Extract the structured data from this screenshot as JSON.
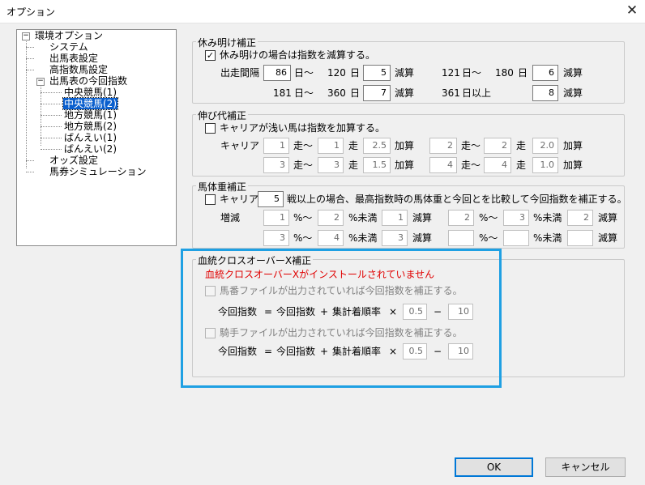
{
  "window": {
    "title": "オプション",
    "close_glyph": "✕"
  },
  "tree": {
    "items": [
      {
        "label": "環境オプション",
        "expander": "−"
      },
      {
        "label": "システム"
      },
      {
        "label": "出馬表設定"
      },
      {
        "label": "高指数馬設定"
      },
      {
        "label": "出馬表の今回指数",
        "expander": "−"
      },
      {
        "label": "中央競馬(1)"
      },
      {
        "label": "中央競馬(2)",
        "selected": true
      },
      {
        "label": "地方競馬(1)"
      },
      {
        "label": "地方競馬(2)"
      },
      {
        "label": "ばんえい(1)"
      },
      {
        "label": "ばんえい(2)"
      },
      {
        "label": "オッズ設定"
      },
      {
        "label": "馬券シミュレーション"
      }
    ]
  },
  "rest": {
    "title": "休み明け補正",
    "checkbox": {
      "label": "休み明けの場合は指数を減算する。",
      "checked": true,
      "mark": "✓"
    },
    "interval_label": "出走間隔",
    "row1": {
      "a": "86",
      "tilde": "日〜",
      "b": "120",
      "day": "日",
      "c": "5",
      "sub": "減算",
      "d": "121",
      "tilde2": "日〜",
      "e": "180",
      "day2": "日",
      "f": "6",
      "sub2": "減算"
    },
    "row2": {
      "a": "181",
      "tilde": "日〜",
      "b": "360",
      "day": "日",
      "c": "7",
      "sub": "減算",
      "d": "361",
      "over": "日以上",
      "f": "8",
      "sub2": "減算"
    }
  },
  "growth": {
    "title": "伸び代補正",
    "checkbox": {
      "label": "キャリアが浅い馬は指数を加算する。",
      "checked": false
    },
    "career_label": "キャリア",
    "from": "走〜",
    "to": "走",
    "add": "加算",
    "row1": {
      "a": "1",
      "b": "1",
      "c": "2.5",
      "d": "2",
      "e": "2",
      "f": "2.0"
    },
    "row2": {
      "a": "3",
      "b": "3",
      "c": "1.5",
      "d": "4",
      "e": "4",
      "f": "1.0"
    }
  },
  "weight": {
    "title": "馬体重補正",
    "checkbox": {
      "label": "キャリア",
      "checked": false
    },
    "career_value": "5",
    "desc": "戦以上の場合、最高指数時の馬体重と今回とを比較して今回指数を補正する。",
    "change_label": "増減",
    "pct_from": "%〜",
    "pct_under": "%未満",
    "sub": "減算",
    "row1": {
      "a": "1",
      "b": "2",
      "c": "1",
      "d": "2",
      "e": "3",
      "f": "2"
    },
    "row2": {
      "a": "3",
      "b": "4",
      "c": "3",
      "d": "",
      "e": "",
      "f": ""
    }
  },
  "crossover": {
    "title": "血統クロスオーバーX補正",
    "warning": "血統クロスオーバーXがインストールされていません",
    "warning_color": "#e00000",
    "horse_checkbox": {
      "label": "馬番ファイルが出力されていれば今回指数を補正する。",
      "checked": false
    },
    "jockey_checkbox": {
      "label": "騎手ファイルが出力されていれば今回指数を補正する。",
      "checked": false
    },
    "formula": {
      "lhs": "今回指数",
      "eq": "=",
      "term1": "今回指数",
      "plus": "+",
      "term2": "集計着順率",
      "times": "×",
      "minus": "−"
    },
    "horse_values": {
      "factor": "0.5",
      "offset": "10"
    },
    "jockey_values": {
      "factor": "0.5",
      "offset": "10"
    }
  },
  "buttons": {
    "ok": "OK",
    "cancel": "キャンセル"
  },
  "colors": {
    "accent": "#1fa0e3",
    "selection": "#0a5fce"
  }
}
